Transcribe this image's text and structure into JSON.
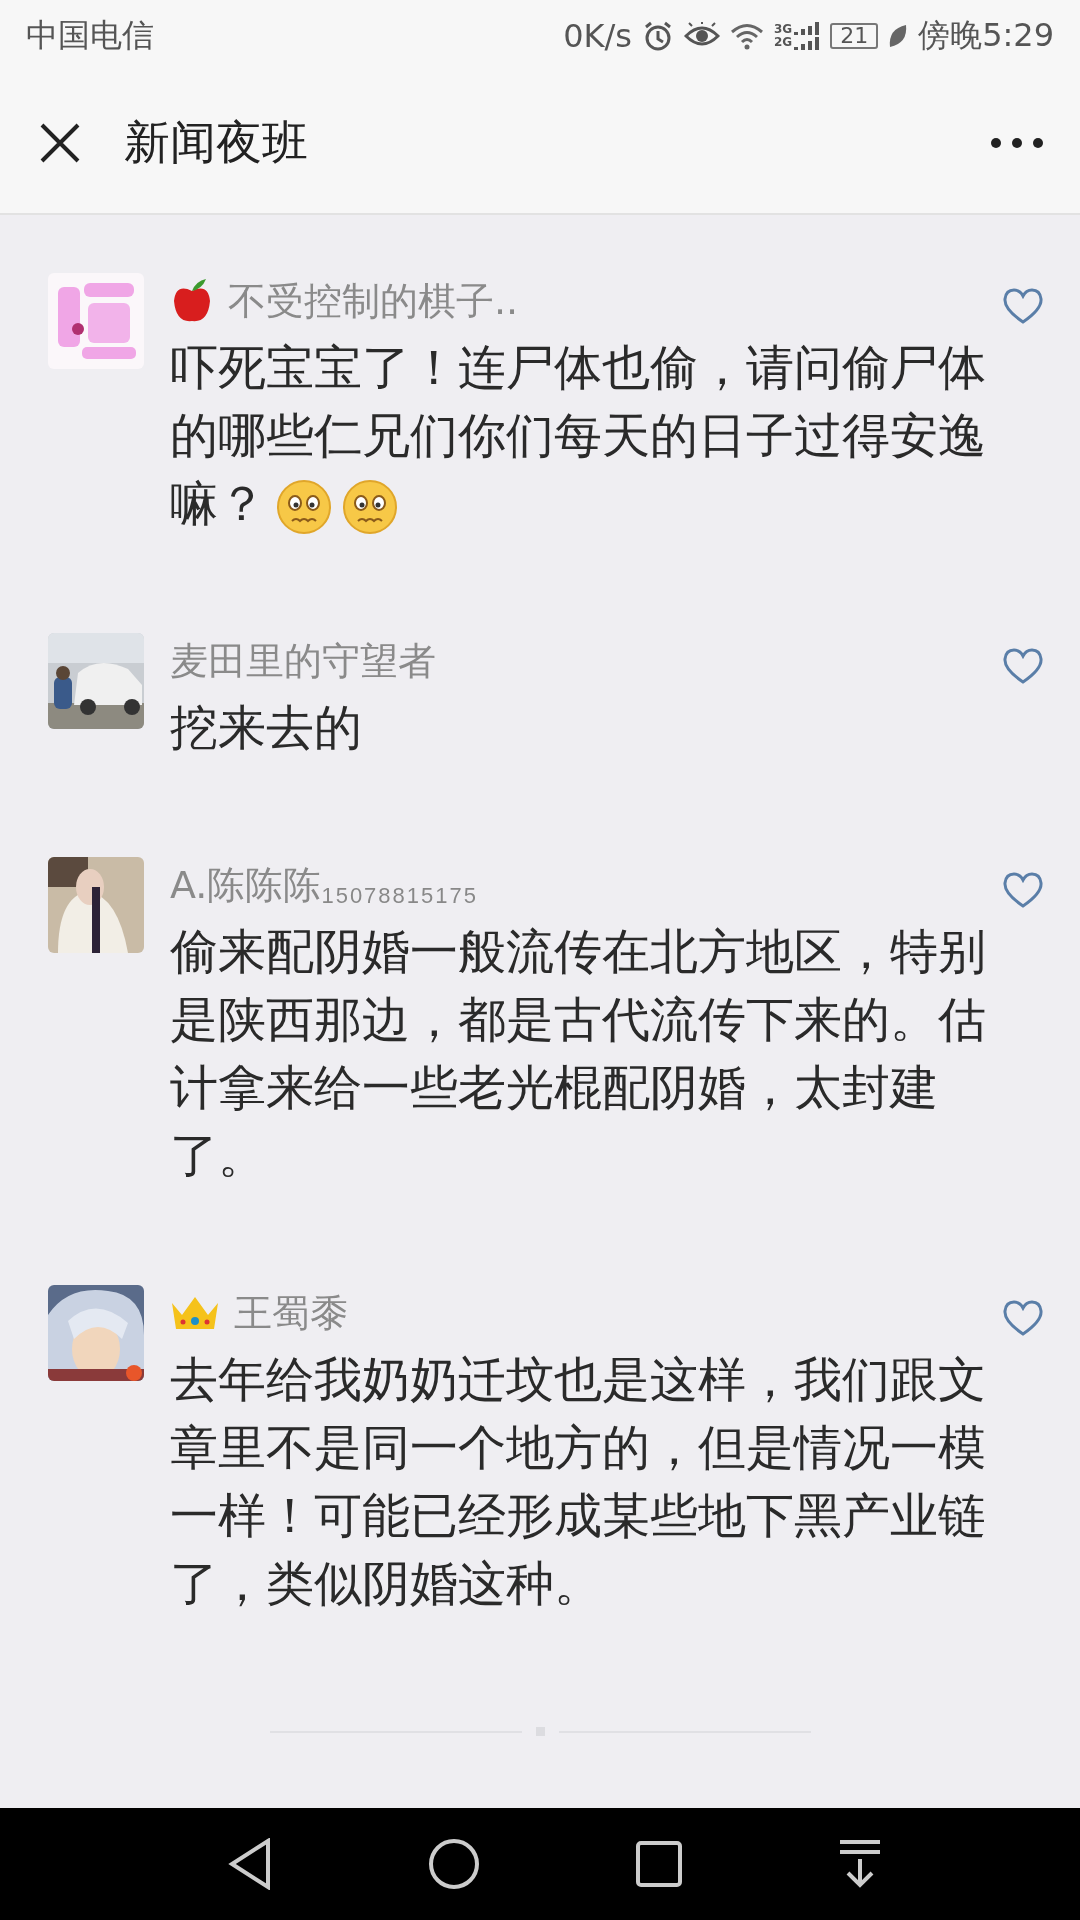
{
  "status_bar": {
    "carrier": "中国电信",
    "net_speed": "0K/s",
    "network_labels": [
      "3G",
      "2G"
    ],
    "battery": "21",
    "time": "傍晚5:29"
  },
  "header": {
    "title": "新闻夜班"
  },
  "comments": [
    {
      "badge": {
        "kind": "apple"
      },
      "name": "不受控制的棋子..",
      "text": "吓死宝宝了！连尸体也偷，请问偷尸体的哪些仁兄们你们每天的日子过得安逸嘛？",
      "emojis": [
        {
          "kind": "worried"
        },
        {
          "kind": "worried"
        }
      ],
      "liked": false
    },
    {
      "name": "麦田里的守望者",
      "text": "挖来去的",
      "liked": false
    },
    {
      "name": "A.陈陈陈",
      "tag": "15078815175",
      "text": "偷来配阴婚一般流传在北方地区，特别是陕西那边，都是古代流传下来的。估计拿来给一些老光棍配阴婚，太封建了。",
      "liked": false
    },
    {
      "badge": {
        "kind": "crown"
      },
      "name": "王蜀黍",
      "text": "去年给我奶奶迁坟也是这样，我们跟文章里不是同一个地方的，但是情况一模一样！可能已经形成某些地下黑产业链了，类似阴婚这种。",
      "liked": false
    }
  ]
}
